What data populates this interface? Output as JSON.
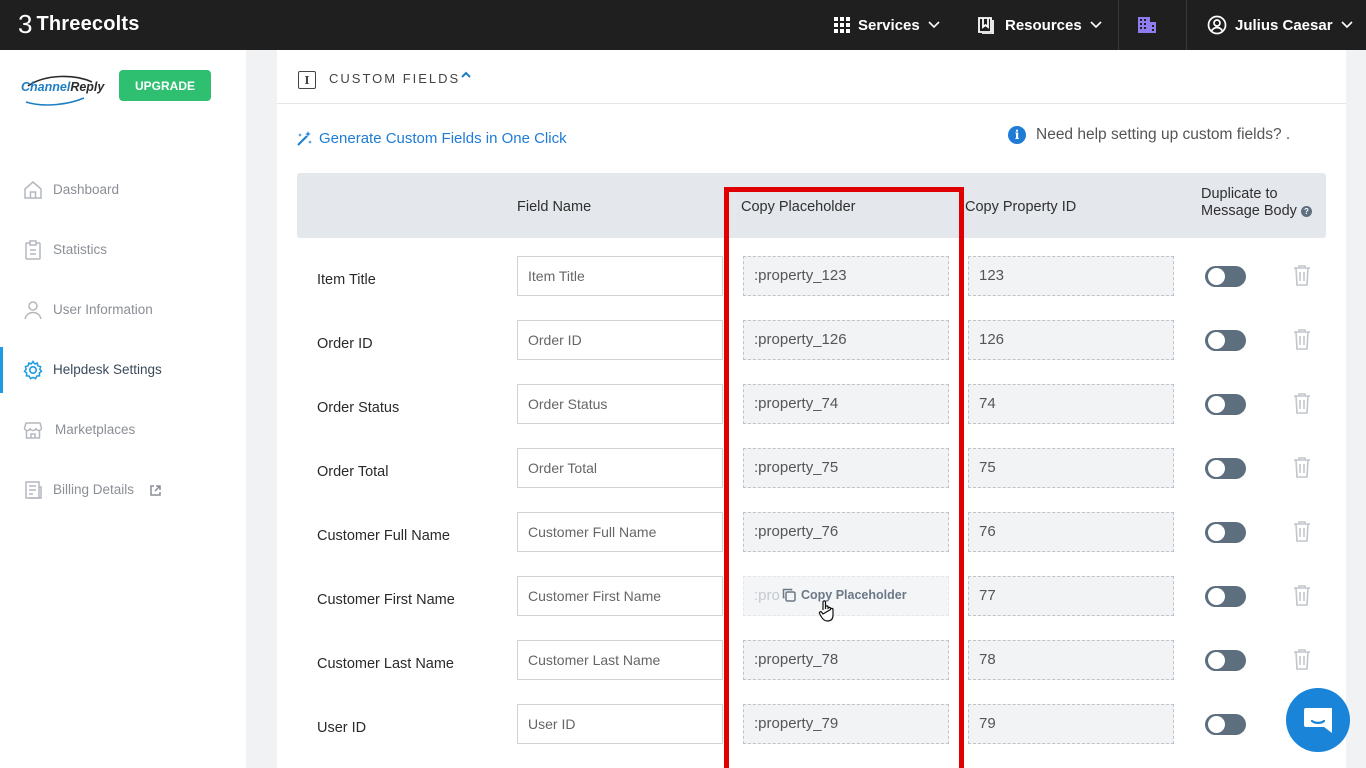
{
  "topbar": {
    "brand_mark": "3",
    "brand_name": "Threecolts",
    "services": "Services",
    "resources": "Resources",
    "user": "Julius Caesar"
  },
  "sidebar": {
    "logo_part1": "Channel",
    "logo_part2": "Reply",
    "upgrade": "UPGRADE",
    "items": [
      {
        "label": "Dashboard",
        "icon": "home-icon"
      },
      {
        "label": "Statistics",
        "icon": "clipboard-icon"
      },
      {
        "label": "User Information",
        "icon": "user-icon"
      },
      {
        "label": "Helpdesk Settings",
        "icon": "gear-icon",
        "active": true
      },
      {
        "label": "Marketplaces",
        "icon": "store-icon"
      },
      {
        "label": "Billing Details",
        "icon": "billing-icon",
        "external": true
      }
    ]
  },
  "section": {
    "title": "CUSTOM FIELDS",
    "generate_link": "Generate Custom Fields in One Click",
    "help_text": "Need help setting up custom fields? ."
  },
  "table": {
    "headers": {
      "field_name": "Field Name",
      "copy_placeholder": "Copy Placeholder",
      "copy_property_id": "Copy Property ID",
      "duplicate_line1": "Duplicate to",
      "duplicate_line2": "Message Body"
    },
    "rows": [
      {
        "label": "Item Title",
        "field": "Item Title",
        "placeholder": ":property_123",
        "property_id": "123"
      },
      {
        "label": "Order ID",
        "field": "Order ID",
        "placeholder": ":property_126",
        "property_id": "126"
      },
      {
        "label": "Order Status",
        "field": "Order Status",
        "placeholder": ":property_74",
        "property_id": "74"
      },
      {
        "label": "Order Total",
        "field": "Order Total",
        "placeholder": ":property_75",
        "property_id": "75"
      },
      {
        "label": "Customer Full Name",
        "field": "Customer Full Name",
        "placeholder": ":property_76",
        "property_id": "76"
      },
      {
        "label": "Customer First Name",
        "field": "Customer First Name",
        "placeholder": ":pro",
        "property_id": "77",
        "hover_tip": "Copy Placeholder"
      },
      {
        "label": "Customer Last Name",
        "field": "Customer Last Name",
        "placeholder": ":property_78",
        "property_id": "78"
      },
      {
        "label": "User ID",
        "field": "User ID",
        "placeholder": ":property_79",
        "property_id": "79"
      }
    ]
  },
  "colors": {
    "accent": "#1e7cd6",
    "upgrade": "#2fbf71",
    "highlight": "#e00000",
    "topbar": "#1f1f1f"
  }
}
